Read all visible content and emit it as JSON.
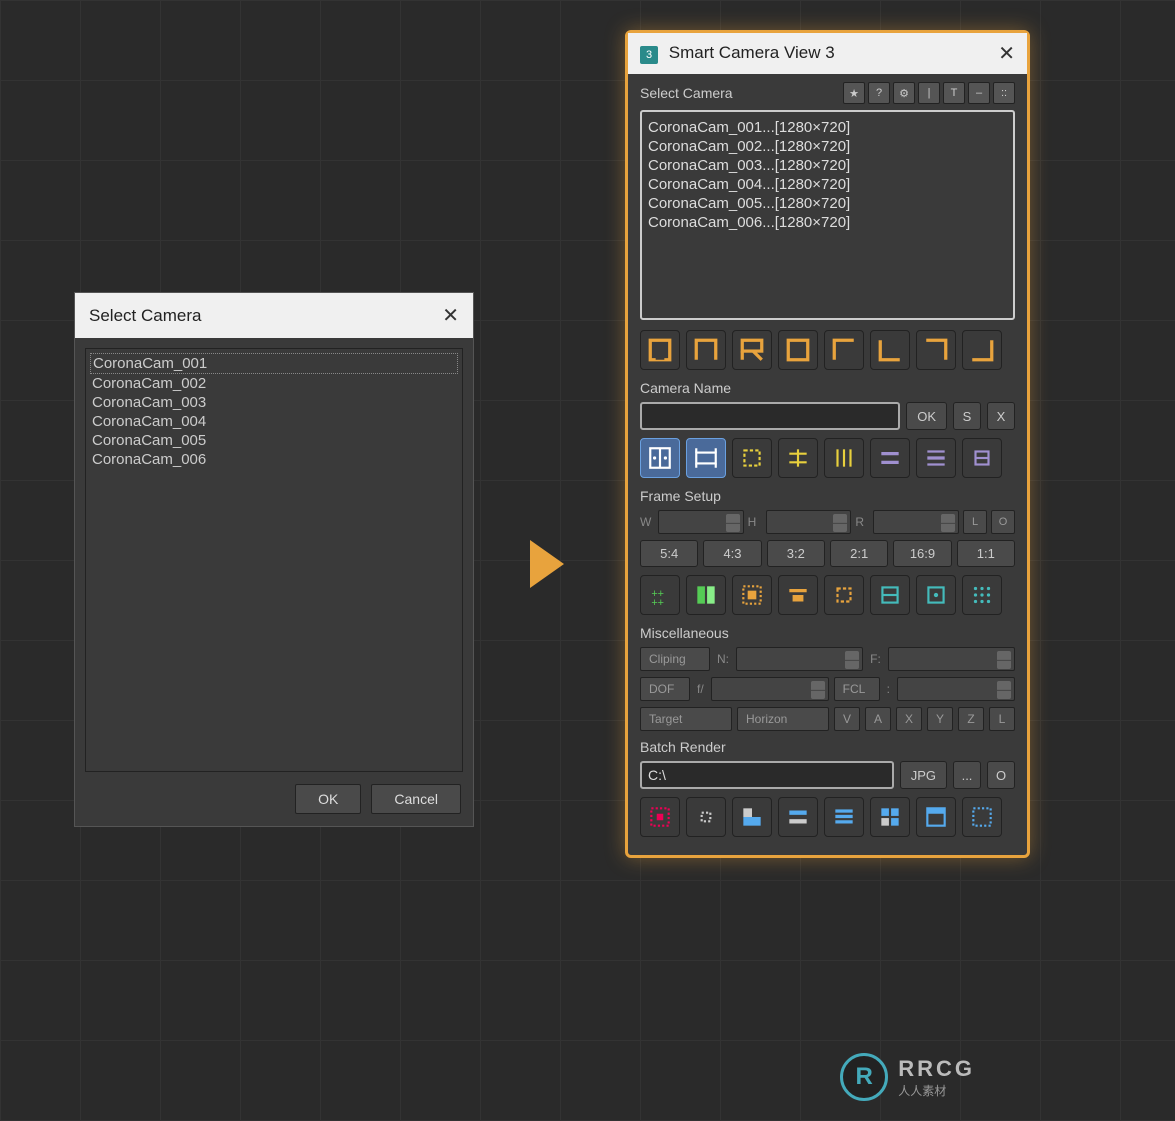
{
  "leftDialog": {
    "title": "Select Camera",
    "items": [
      "CoronaCam_001",
      "CoronaCam_002",
      "CoronaCam_003",
      "CoronaCam_004",
      "CoronaCam_005",
      "CoronaCam_006"
    ],
    "ok": "OK",
    "cancel": "Cancel"
  },
  "rightPanel": {
    "title": "Smart Camera View 3",
    "appIcon": "3",
    "selectLabel": "Select Camera",
    "topBtns": [
      "★",
      "?",
      "⚙",
      "|",
      "T",
      "–",
      "::"
    ],
    "cameras": [
      "CoronaCam_001...[1280×720]",
      "CoronaCam_002...[1280×720]",
      "CoronaCam_003...[1280×720]",
      "CoronaCam_004...[1280×720]",
      "CoronaCam_005...[1280×720]",
      "CoronaCam_006...[1280×720]"
    ],
    "camNameLabel": "Camera Name",
    "camNameBtns": [
      "OK",
      "S",
      "X"
    ],
    "frameLabel": "Frame Setup",
    "frameFields": [
      "W",
      "H",
      "R"
    ],
    "frameSide": [
      "L",
      "O"
    ],
    "ratios": [
      "5:4",
      "4:3",
      "3:2",
      "2:1",
      "16:9",
      "1:1"
    ],
    "miscLabel": "Miscellaneous",
    "misc": {
      "cliping": "Cliping",
      "n": "N:",
      "f": "F:",
      "dof": "DOF",
      "fslash": "f/",
      "fcl": "FCL",
      "colon": ":",
      "target": "Target",
      "horizon": "Horizon",
      "axes": [
        "V",
        "A",
        "X",
        "Y",
        "Z",
        "L"
      ]
    },
    "batchLabel": "Batch Render",
    "batch": {
      "path": "C:\\",
      "fmt": "JPG",
      "browse": "...",
      "o": "O"
    }
  },
  "watermark": {
    "logo": "R",
    "line1": "RRCG",
    "line2": "人人素材"
  }
}
